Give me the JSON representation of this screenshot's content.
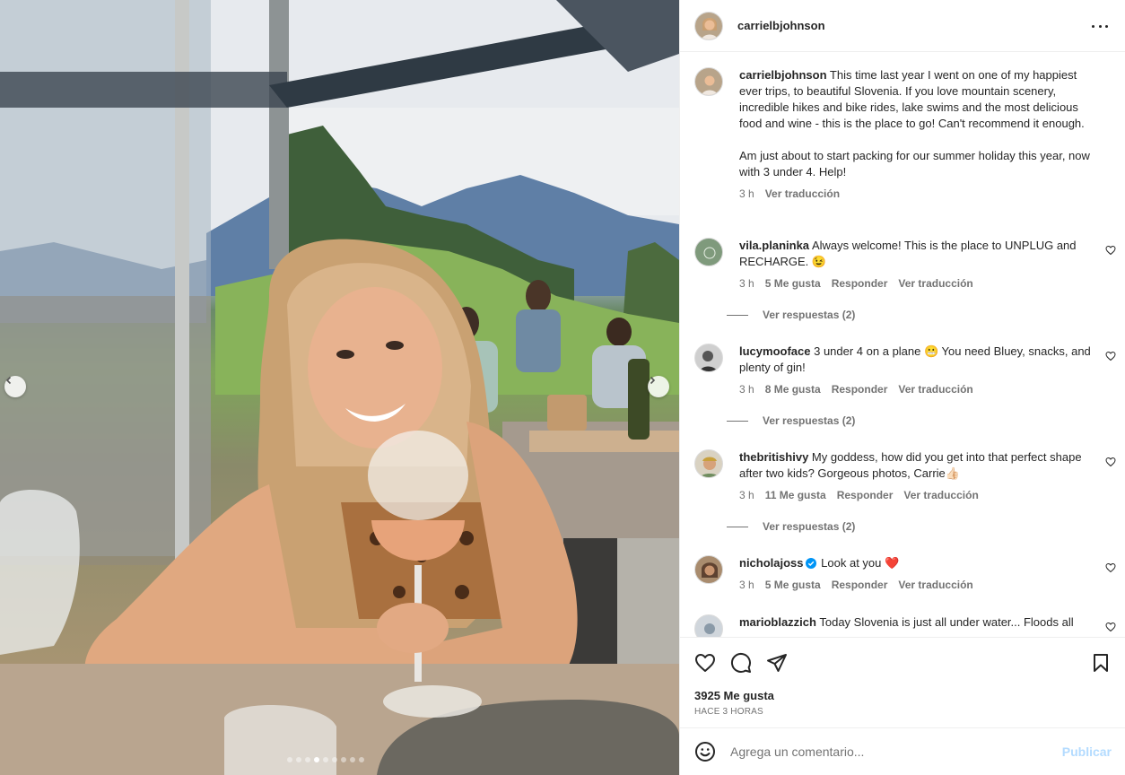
{
  "post": {
    "username": "carrielbjohnson",
    "caption_username": "carrielbjohnson",
    "caption_p1": "This time last year I went on one of my happiest ever trips, to beautiful Slovenia. If you love mountain scenery, incredible hikes and bike rides, lake swims and the most delicious food and wine - this is the place to go! Can't recommend it enough.",
    "caption_p2": "Am just about to start packing for our summer holiday this year, now with 3 under 4. Help!",
    "caption_time": "3 h",
    "translate": "Ver traducción"
  },
  "comments": [
    {
      "user": "vila.planinka",
      "text": "Always welcome! This is the place to UNPLUG and RECHARGE. 😉",
      "time": "3 h",
      "likes": "5 Me gusta",
      "reply": "Responder",
      "translate": "Ver traducción",
      "replies": "Ver respuestas (2)"
    },
    {
      "user": "lucymooface",
      "text": "3 under 4 on a plane 😬 You need Bluey, snacks, and plenty of gin!",
      "time": "3 h",
      "likes": "8 Me gusta",
      "reply": "Responder",
      "translate": "Ver traducción",
      "replies": "Ver respuestas (2)"
    },
    {
      "user": "thebritishivy",
      "text": "My goddess, how did you get into that perfect shape after two kids? Gorgeous photos, Carrie👍🏻",
      "time": "3 h",
      "likes": "11 Me gusta",
      "reply": "Responder",
      "translate": "Ver traducción",
      "replies": "Ver respuestas (2)"
    },
    {
      "user": "nicholajoss",
      "text": "Look at you ❤️",
      "time": "3 h",
      "likes": "5 Me gusta",
      "reply": "Responder",
      "translate": "Ver traducción"
    },
    {
      "user": "marioblazzich",
      "text": "Today Slovenia is just all under water... Floods all"
    }
  ],
  "actions": {
    "likes": "3925 Me gusta",
    "ago": "HACE 3 HORAS"
  },
  "composer": {
    "placeholder": "Agrega un comentario...",
    "post_label": "Publicar"
  },
  "icons": {
    "like": "heart-icon",
    "comment": "comment-icon",
    "share": "paper-plane-icon",
    "save": "bookmark-icon",
    "emoji": "smiley-icon",
    "more": "more-horizontal-icon"
  },
  "carousel": {
    "slides": 9,
    "active": 3
  },
  "colors": {
    "link": "#0095f6",
    "post_disabled": "#b3dbff",
    "heart_red": "#ed4956",
    "verified": "#0095f6"
  }
}
